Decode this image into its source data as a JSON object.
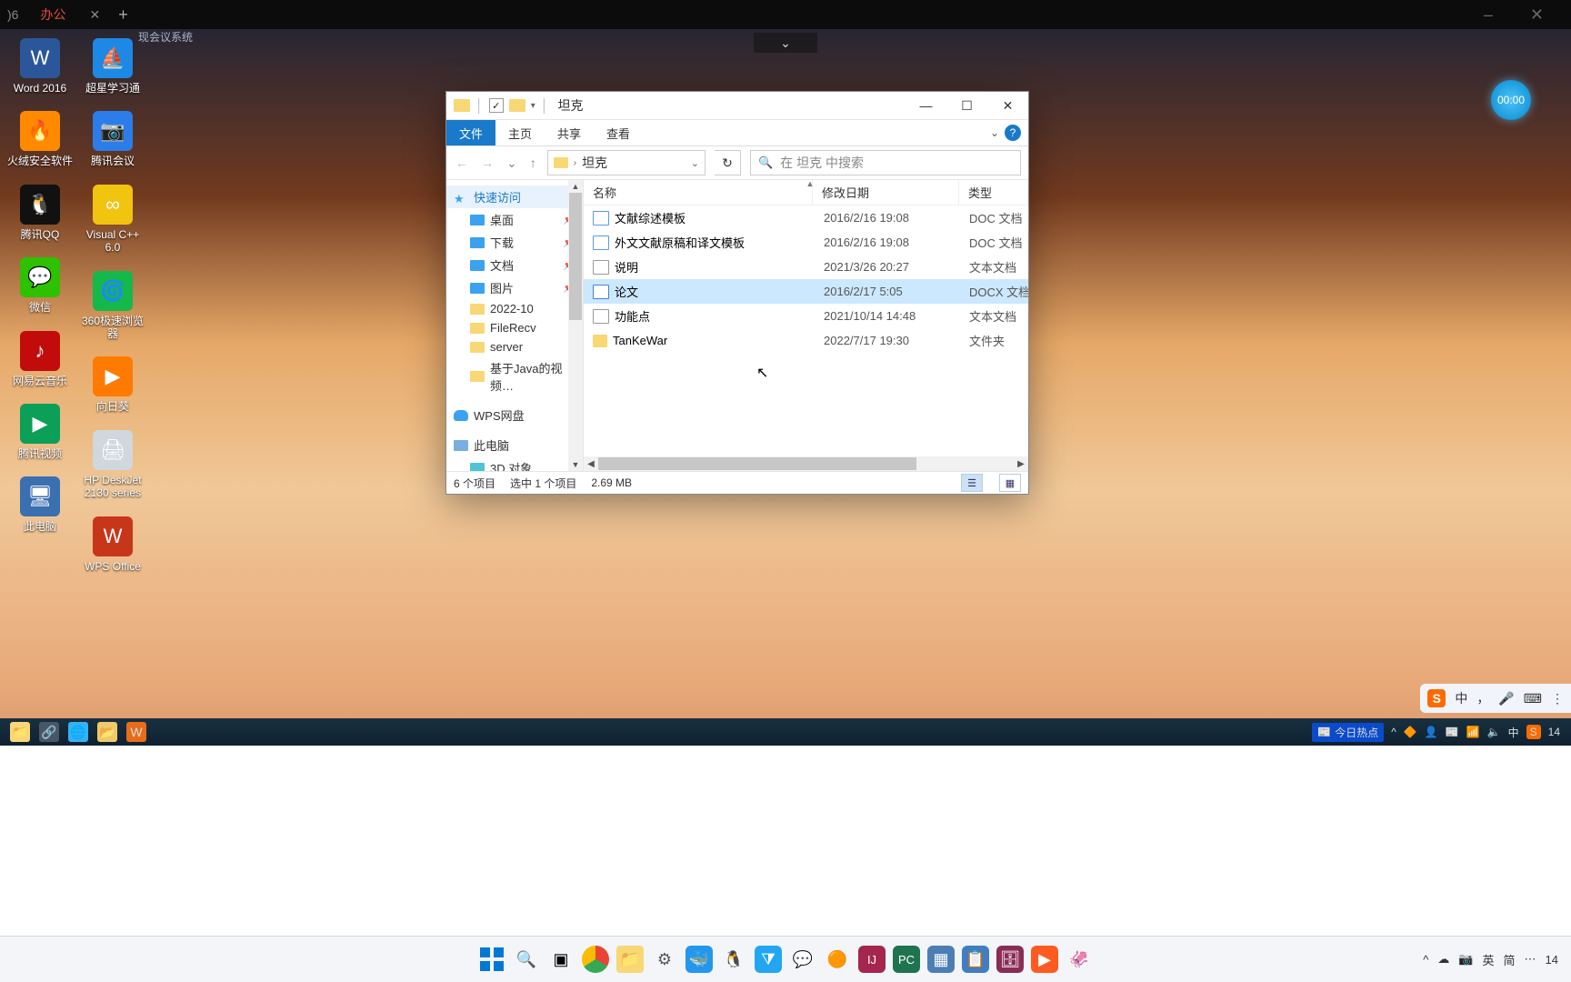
{
  "top_tab": "办公",
  "top_tab2": "现会议系统",
  "timer": "00:00",
  "desk_col1": [
    {
      "label": "Word 2016",
      "bg": "#2b579a",
      "glyph": "W"
    },
    {
      "label": "火绒安全软件",
      "bg": "#ff8a00",
      "glyph": "🔥"
    },
    {
      "label": "腾讯QQ",
      "bg": "#111",
      "glyph": "🐧"
    },
    {
      "label": "微信",
      "bg": "#2dc100",
      "glyph": "💬"
    },
    {
      "label": "网易云音乐",
      "bg": "#c20c0c",
      "glyph": "♪"
    },
    {
      "label": "腾讯视频",
      "bg": "#0b9f58",
      "glyph": "▶"
    },
    {
      "label": "此电脑",
      "bg": "#3a6fb0",
      "glyph": "🖥"
    }
  ],
  "desk_col2": [
    {
      "label": "超星学习通",
      "bg": "#1e88e5",
      "glyph": "⛵"
    },
    {
      "label": "腾讯会议",
      "bg": "#2b7de9",
      "glyph": "📷"
    },
    {
      "label": "Visual C++ 6.0",
      "bg": "#f1c40f",
      "glyph": "∞"
    },
    {
      "label": "360极速浏览器",
      "bg": "#14b84b",
      "glyph": "🌀"
    },
    {
      "label": "向日葵",
      "bg": "#ff7a00",
      "glyph": "▶"
    },
    {
      "label": "HP DeskJet 2130 series",
      "bg": "#d0d7df",
      "glyph": "🖨"
    },
    {
      "label": "WPS Office",
      "bg": "#c8361a",
      "glyph": "W"
    }
  ],
  "explorer": {
    "title": "坦克",
    "tabs": {
      "file": "文件",
      "home": "主页",
      "share": "共享",
      "view": "查看"
    },
    "breadcrumb": "坦克",
    "search_placeholder": "在 坦克 中搜索",
    "nav": {
      "quick": "快速访问",
      "desktop": "桌面",
      "downloads": "下载",
      "documents": "文档",
      "pictures": "图片",
      "f1": "2022-10",
      "f2": "FileRecv",
      "f3": "server",
      "f4": "基于Java的视频…",
      "wps": "WPS网盘",
      "thispc": "此电脑",
      "threed": "3D 对象"
    },
    "headers": {
      "name": "名称",
      "date": "修改日期",
      "type": "类型"
    },
    "files": [
      {
        "name": "TanKeWar",
        "date": "2022/7/17 19:30",
        "type": "文件夹",
        "kind": "folder"
      },
      {
        "name": "功能点",
        "date": "2021/10/14 14:48",
        "type": "文本文档",
        "kind": "txt"
      },
      {
        "name": "论文",
        "date": "2016/2/17 5:05",
        "type": "DOCX 文档",
        "kind": "docx",
        "selected": true
      },
      {
        "name": "说明",
        "date": "2021/3/26 20:27",
        "type": "文本文档",
        "kind": "txt"
      },
      {
        "name": "外文文献原稿和译文模板",
        "date": "2016/2/16 19:08",
        "type": "DOC 文档",
        "kind": "doc"
      },
      {
        "name": "文献综述模板",
        "date": "2016/2/16 19:08",
        "type": "DOC 文档",
        "kind": "doc"
      }
    ],
    "status": {
      "count": "6 个项目",
      "selected": "选中 1 个项目",
      "size": "2.69 MB"
    }
  },
  "ime": {
    "zhong": "中",
    "dot": "，",
    "jian": "简"
  },
  "taskbar1": {
    "hot": "今日热点",
    "lang": "中",
    "time": "14"
  },
  "taskbar2": {
    "ime_che": "英",
    "ime_type": "简",
    "time": "14"
  }
}
